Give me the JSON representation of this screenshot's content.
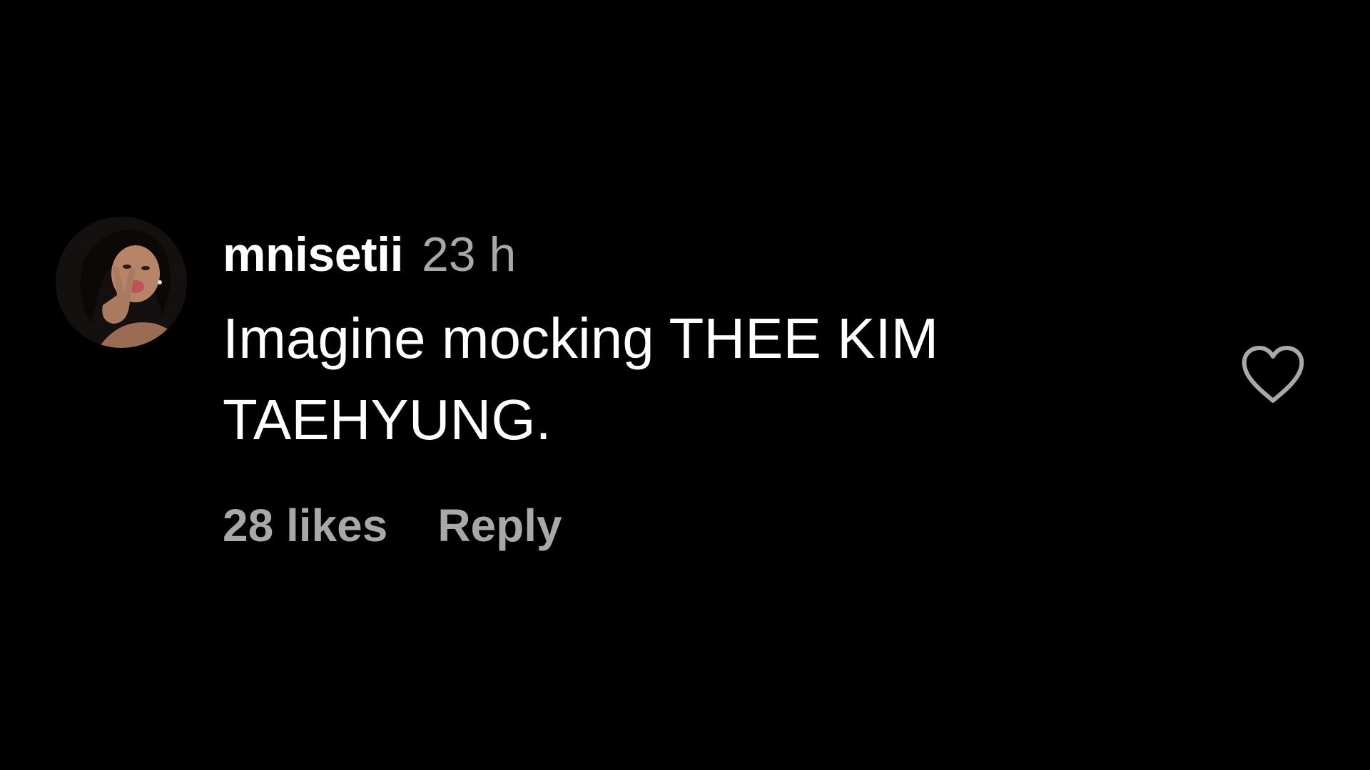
{
  "comment": {
    "username": "mnisetii",
    "timestamp": "23 h",
    "text": "Imagine mocking THEE KIM TAEHYUNG.",
    "likes_label": "28 likes",
    "reply_label": "Reply",
    "like_icon": "heart-outline-icon",
    "avatar_icon": "profile-photo"
  },
  "colors": {
    "background": "#000000",
    "primary_text": "#ffffff",
    "secondary_text": "#a8a8a8"
  }
}
